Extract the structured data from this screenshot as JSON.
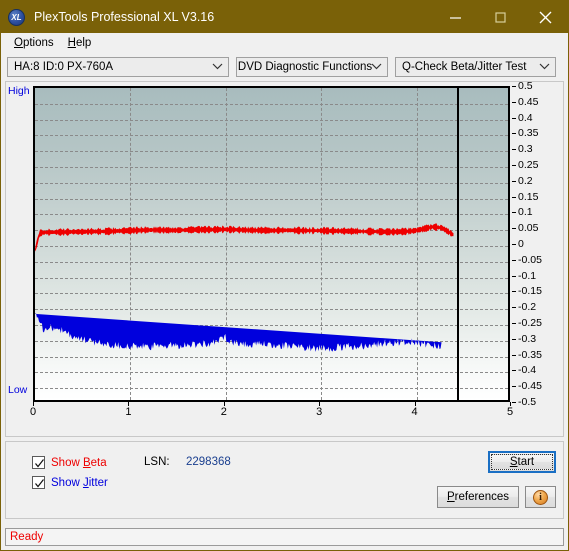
{
  "window": {
    "title": "PlexTools Professional XL V3.16",
    "logo_text": "XL",
    "minimize_icon": "minimize-icon",
    "maximize_icon": "maximize-icon",
    "close_icon": "close-icon",
    "titlebar_color": "#7a6108"
  },
  "menu": {
    "items": [
      {
        "label": "Options",
        "accel": "O"
      },
      {
        "label": "Help",
        "accel": "H"
      }
    ]
  },
  "toolbar": {
    "drive_select": "HA:8 ID:0  PX-760A",
    "function_select": "DVD Diagnostic Functions",
    "test_select": "Q-Check Beta/Jitter Test",
    "chevron_icon": "chevron-down-icon"
  },
  "controls": {
    "show_beta_label": "Show Beta",
    "show_beta_accel": "B",
    "show_beta_checked": true,
    "show_beta_color": "#ee0000",
    "show_jitter_label": "Show Jitter",
    "show_jitter_accel": "J",
    "show_jitter_checked": true,
    "show_jitter_color": "#0000dd",
    "lsn_label": "LSN:",
    "lsn_value": "2298368",
    "start_label": "Start",
    "start_accel": "S",
    "preferences_label": "Preferences",
    "preferences_accel": "P",
    "info_label": "i",
    "info_icon": "info-icon"
  },
  "status": {
    "text": "Ready",
    "color": "#ee0000"
  },
  "chart_data": {
    "type": "line",
    "title": "Q-Check Beta/Jitter Test",
    "xlabel": "",
    "ylabel": "",
    "xlim": [
      0,
      5
    ],
    "ylim": [
      -0.5,
      0.5
    ],
    "xticks": [
      0,
      1,
      2,
      3,
      4,
      5
    ],
    "yticks": [
      0.5,
      0.45,
      0.4,
      0.35,
      0.3,
      0.25,
      0.2,
      0.15,
      0.1,
      0.05,
      0,
      -0.05,
      -0.1,
      -0.15,
      -0.2,
      -0.25,
      -0.3,
      -0.35,
      -0.4,
      -0.45,
      -0.5
    ],
    "ytick_labels": [
      "0.5",
      "0.45",
      "0.4",
      "0.35",
      "0.3",
      "0.25",
      "0.2",
      "0.15",
      "0.1",
      "0.05",
      "0",
      "-0.05",
      "-0.1",
      "-0.15",
      "-0.2",
      "-0.25",
      "-0.3",
      "-0.35",
      "-0.4",
      "-0.45",
      "-0.5"
    ],
    "axis_left_label_top": "High",
    "axis_left_label_bottom": "Low",
    "grid": true,
    "grid_style": "dashed",
    "marker_x": 4.42,
    "data_end_x": 4.42,
    "bg_gradient": [
      "#a8bcbe",
      "#ffffff"
    ],
    "series": [
      {
        "name": "Beta",
        "color": "#ee0000",
        "x": [
          0.0,
          0.05,
          0.1,
          0.2,
          0.3,
          0.4,
          0.5,
          0.6,
          0.7,
          0.8,
          0.9,
          1.0,
          1.1,
          1.2,
          1.3,
          1.4,
          1.5,
          1.6,
          1.7,
          1.8,
          1.9,
          2.0,
          2.1,
          2.2,
          2.3,
          2.4,
          2.5,
          2.6,
          2.7,
          2.8,
          2.9,
          3.0,
          3.1,
          3.2,
          3.3,
          3.4,
          3.5,
          3.6,
          3.7,
          3.8,
          3.9,
          4.0,
          4.1,
          4.2,
          4.3,
          4.42
        ],
        "values": [
          -0.02,
          0.035,
          0.037,
          0.038,
          0.038,
          0.039,
          0.039,
          0.04,
          0.04,
          0.041,
          0.042,
          0.043,
          0.044,
          0.045,
          0.045,
          0.044,
          0.044,
          0.045,
          0.046,
          0.046,
          0.046,
          0.047,
          0.046,
          0.045,
          0.044,
          0.044,
          0.043,
          0.044,
          0.044,
          0.043,
          0.043,
          0.043,
          0.042,
          0.042,
          0.041,
          0.041,
          0.04,
          0.04,
          0.039,
          0.039,
          0.04,
          0.042,
          0.048,
          0.055,
          0.052,
          0.03
        ],
        "band": 0.008
      },
      {
        "name": "Jitter",
        "color": "#0000dd",
        "x": [
          0.0,
          0.05,
          0.1,
          0.15,
          0.2,
          0.25,
          0.3,
          0.4,
          0.5,
          0.6,
          0.7,
          0.8,
          0.9,
          1.0,
          1.1,
          1.2,
          1.3,
          1.4,
          1.5,
          1.6,
          1.7,
          1.8,
          1.9,
          2.0,
          2.1,
          2.2,
          2.3,
          2.4,
          2.5,
          2.6,
          2.7,
          2.8,
          2.9,
          3.0,
          3.1,
          3.2,
          3.3,
          3.4,
          3.5,
          3.6,
          3.7,
          3.8,
          3.9,
          4.0,
          4.1,
          4.2,
          4.3,
          4.42
        ],
        "values": [
          -0.235,
          -0.275,
          -0.3,
          -0.285,
          -0.3,
          -0.29,
          -0.305,
          -0.32,
          -0.33,
          -0.335,
          -0.34,
          -0.345,
          -0.348,
          -0.35,
          -0.352,
          -0.352,
          -0.35,
          -0.348,
          -0.348,
          -0.345,
          -0.344,
          -0.342,
          -0.34,
          -0.32,
          -0.338,
          -0.342,
          -0.344,
          -0.345,
          -0.346,
          -0.348,
          -0.35,
          -0.352,
          -0.354,
          -0.356,
          -0.356,
          -0.355,
          -0.352,
          -0.35,
          -0.348,
          -0.344,
          -0.34,
          -0.338,
          -0.336,
          -0.338,
          -0.342,
          -0.346,
          -0.35
        ],
        "band": 0.022
      }
    ]
  }
}
